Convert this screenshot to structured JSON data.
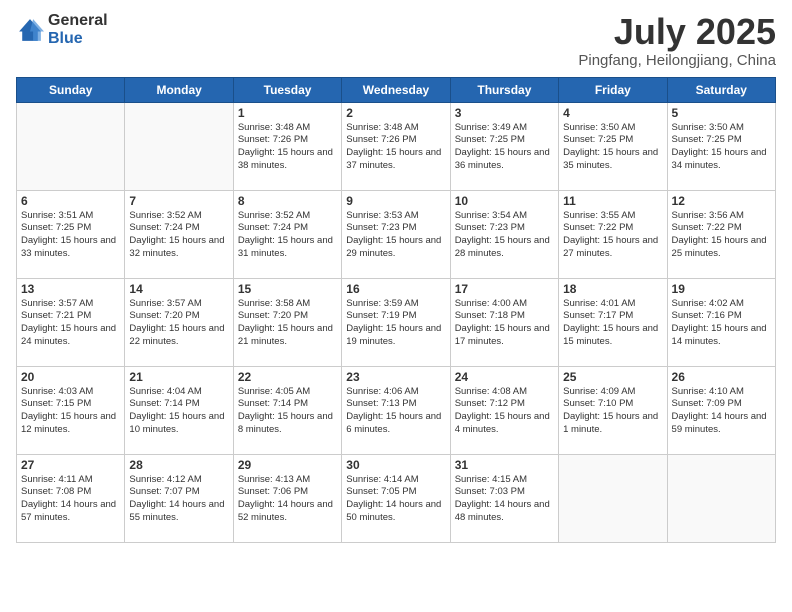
{
  "logo": {
    "general": "General",
    "blue": "Blue"
  },
  "title": "July 2025",
  "subtitle": "Pingfang, Heilongjiang, China",
  "headers": [
    "Sunday",
    "Monday",
    "Tuesday",
    "Wednesday",
    "Thursday",
    "Friday",
    "Saturday"
  ],
  "weeks": [
    [
      {
        "day": "",
        "sunrise": "",
        "sunset": "",
        "daylight": ""
      },
      {
        "day": "",
        "sunrise": "",
        "sunset": "",
        "daylight": ""
      },
      {
        "day": "1",
        "sunrise": "Sunrise: 3:48 AM",
        "sunset": "Sunset: 7:26 PM",
        "daylight": "Daylight: 15 hours and 38 minutes."
      },
      {
        "day": "2",
        "sunrise": "Sunrise: 3:48 AM",
        "sunset": "Sunset: 7:26 PM",
        "daylight": "Daylight: 15 hours and 37 minutes."
      },
      {
        "day": "3",
        "sunrise": "Sunrise: 3:49 AM",
        "sunset": "Sunset: 7:25 PM",
        "daylight": "Daylight: 15 hours and 36 minutes."
      },
      {
        "day": "4",
        "sunrise": "Sunrise: 3:50 AM",
        "sunset": "Sunset: 7:25 PM",
        "daylight": "Daylight: 15 hours and 35 minutes."
      },
      {
        "day": "5",
        "sunrise": "Sunrise: 3:50 AM",
        "sunset": "Sunset: 7:25 PM",
        "daylight": "Daylight: 15 hours and 34 minutes."
      }
    ],
    [
      {
        "day": "6",
        "sunrise": "Sunrise: 3:51 AM",
        "sunset": "Sunset: 7:25 PM",
        "daylight": "Daylight: 15 hours and 33 minutes."
      },
      {
        "day": "7",
        "sunrise": "Sunrise: 3:52 AM",
        "sunset": "Sunset: 7:24 PM",
        "daylight": "Daylight: 15 hours and 32 minutes."
      },
      {
        "day": "8",
        "sunrise": "Sunrise: 3:52 AM",
        "sunset": "Sunset: 7:24 PM",
        "daylight": "Daylight: 15 hours and 31 minutes."
      },
      {
        "day": "9",
        "sunrise": "Sunrise: 3:53 AM",
        "sunset": "Sunset: 7:23 PM",
        "daylight": "Daylight: 15 hours and 29 minutes."
      },
      {
        "day": "10",
        "sunrise": "Sunrise: 3:54 AM",
        "sunset": "Sunset: 7:23 PM",
        "daylight": "Daylight: 15 hours and 28 minutes."
      },
      {
        "day": "11",
        "sunrise": "Sunrise: 3:55 AM",
        "sunset": "Sunset: 7:22 PM",
        "daylight": "Daylight: 15 hours and 27 minutes."
      },
      {
        "day": "12",
        "sunrise": "Sunrise: 3:56 AM",
        "sunset": "Sunset: 7:22 PM",
        "daylight": "Daylight: 15 hours and 25 minutes."
      }
    ],
    [
      {
        "day": "13",
        "sunrise": "Sunrise: 3:57 AM",
        "sunset": "Sunset: 7:21 PM",
        "daylight": "Daylight: 15 hours and 24 minutes."
      },
      {
        "day": "14",
        "sunrise": "Sunrise: 3:57 AM",
        "sunset": "Sunset: 7:20 PM",
        "daylight": "Daylight: 15 hours and 22 minutes."
      },
      {
        "day": "15",
        "sunrise": "Sunrise: 3:58 AM",
        "sunset": "Sunset: 7:20 PM",
        "daylight": "Daylight: 15 hours and 21 minutes."
      },
      {
        "day": "16",
        "sunrise": "Sunrise: 3:59 AM",
        "sunset": "Sunset: 7:19 PM",
        "daylight": "Daylight: 15 hours and 19 minutes."
      },
      {
        "day": "17",
        "sunrise": "Sunrise: 4:00 AM",
        "sunset": "Sunset: 7:18 PM",
        "daylight": "Daylight: 15 hours and 17 minutes."
      },
      {
        "day": "18",
        "sunrise": "Sunrise: 4:01 AM",
        "sunset": "Sunset: 7:17 PM",
        "daylight": "Daylight: 15 hours and 15 minutes."
      },
      {
        "day": "19",
        "sunrise": "Sunrise: 4:02 AM",
        "sunset": "Sunset: 7:16 PM",
        "daylight": "Daylight: 15 hours and 14 minutes."
      }
    ],
    [
      {
        "day": "20",
        "sunrise": "Sunrise: 4:03 AM",
        "sunset": "Sunset: 7:15 PM",
        "daylight": "Daylight: 15 hours and 12 minutes."
      },
      {
        "day": "21",
        "sunrise": "Sunrise: 4:04 AM",
        "sunset": "Sunset: 7:14 PM",
        "daylight": "Daylight: 15 hours and 10 minutes."
      },
      {
        "day": "22",
        "sunrise": "Sunrise: 4:05 AM",
        "sunset": "Sunset: 7:14 PM",
        "daylight": "Daylight: 15 hours and 8 minutes."
      },
      {
        "day": "23",
        "sunrise": "Sunrise: 4:06 AM",
        "sunset": "Sunset: 7:13 PM",
        "daylight": "Daylight: 15 hours and 6 minutes."
      },
      {
        "day": "24",
        "sunrise": "Sunrise: 4:08 AM",
        "sunset": "Sunset: 7:12 PM",
        "daylight": "Daylight: 15 hours and 4 minutes."
      },
      {
        "day": "25",
        "sunrise": "Sunrise: 4:09 AM",
        "sunset": "Sunset: 7:10 PM",
        "daylight": "Daylight: 15 hours and 1 minute."
      },
      {
        "day": "26",
        "sunrise": "Sunrise: 4:10 AM",
        "sunset": "Sunset: 7:09 PM",
        "daylight": "Daylight: 14 hours and 59 minutes."
      }
    ],
    [
      {
        "day": "27",
        "sunrise": "Sunrise: 4:11 AM",
        "sunset": "Sunset: 7:08 PM",
        "daylight": "Daylight: 14 hours and 57 minutes."
      },
      {
        "day": "28",
        "sunrise": "Sunrise: 4:12 AM",
        "sunset": "Sunset: 7:07 PM",
        "daylight": "Daylight: 14 hours and 55 minutes."
      },
      {
        "day": "29",
        "sunrise": "Sunrise: 4:13 AM",
        "sunset": "Sunset: 7:06 PM",
        "daylight": "Daylight: 14 hours and 52 minutes."
      },
      {
        "day": "30",
        "sunrise": "Sunrise: 4:14 AM",
        "sunset": "Sunset: 7:05 PM",
        "daylight": "Daylight: 14 hours and 50 minutes."
      },
      {
        "day": "31",
        "sunrise": "Sunrise: 4:15 AM",
        "sunset": "Sunset: 7:03 PM",
        "daylight": "Daylight: 14 hours and 48 minutes."
      },
      {
        "day": "",
        "sunrise": "",
        "sunset": "",
        "daylight": ""
      },
      {
        "day": "",
        "sunrise": "",
        "sunset": "",
        "daylight": ""
      }
    ]
  ]
}
